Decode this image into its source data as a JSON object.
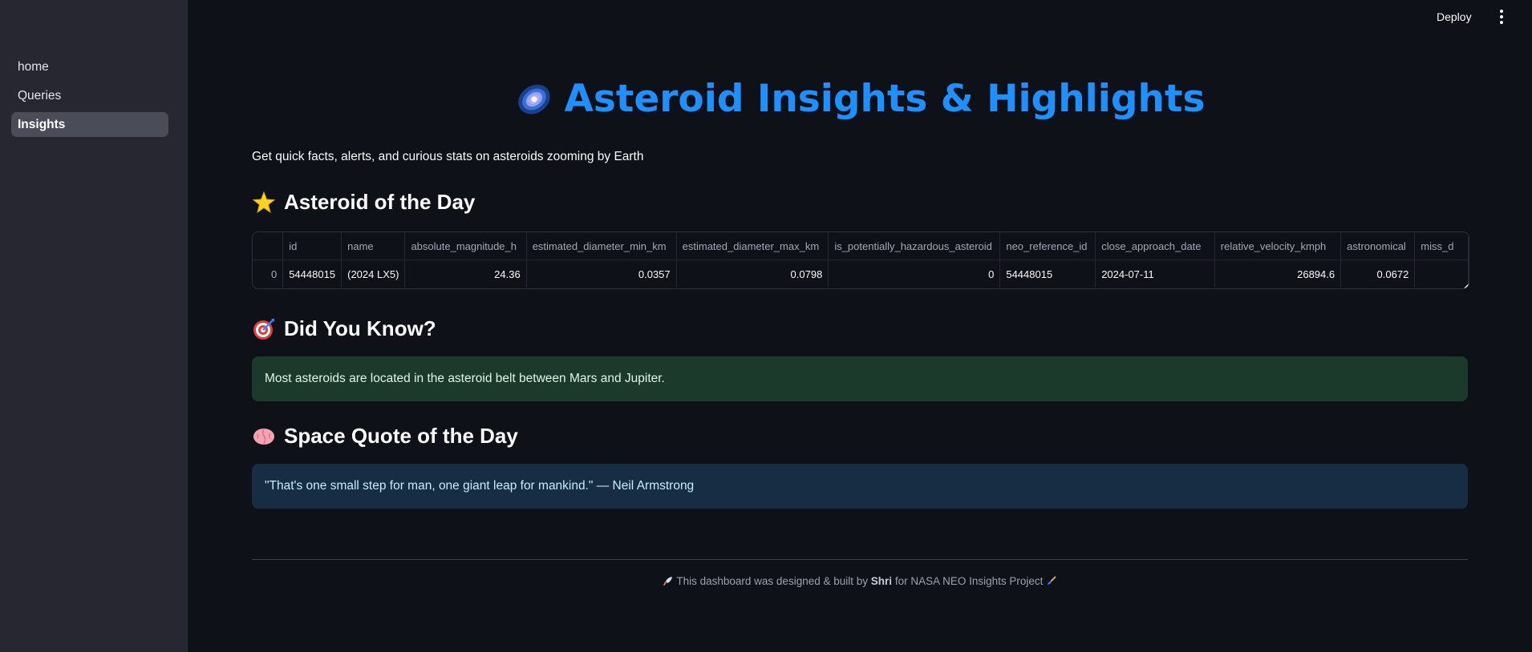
{
  "sidebar": {
    "items": [
      {
        "label": "home",
        "active": false
      },
      {
        "label": "Queries",
        "active": false
      },
      {
        "label": "Insights",
        "active": true
      }
    ]
  },
  "topbar": {
    "deploy_label": "Deploy",
    "menu_icon": "kebab-menu-icon"
  },
  "header": {
    "icon": "galaxy-icon",
    "title": "Asteroid Insights & Highlights",
    "subtitle": "Get quick facts, alerts, and curious stats on asteroids zooming by Earth"
  },
  "asteroid_of_day": {
    "icon": "star-icon",
    "heading": "Asteroid of the Day",
    "columns": [
      "",
      "id",
      "name",
      "absolute_magnitude_h",
      "estimated_diameter_min_km",
      "estimated_diameter_max_km",
      "is_potentially_hazardous_asteroid",
      "neo_reference_id",
      "close_approach_date",
      "relative_velocity_kmph",
      "astronomical",
      "miss_d"
    ],
    "row": [
      "0",
      "54448015",
      "(2024 LX5)",
      "24.36",
      "0.0357",
      "0.0798",
      "0",
      "54448015",
      "2024-07-11",
      "26894.6",
      "0.0672",
      ""
    ]
  },
  "did_you_know": {
    "icon": "target-icon",
    "heading": "Did You Know?",
    "text": "Most asteroids are located in the asteroid belt between Mars and Jupiter."
  },
  "space_quote": {
    "icon": "brain-icon",
    "heading": "Space Quote of the Day",
    "text": "\"That's one small step for man, one giant leap for mankind.\" — Neil Armstrong"
  },
  "footer": {
    "prefix": "This dashboard was designed & built by",
    "author": "Shri",
    "suffix": "for NASA NEO Insights Project"
  },
  "colors": {
    "background": "#0e1117",
    "sidebar": "#262730",
    "title_accent": "#1e90ff",
    "success_bg": "#1b3a2b",
    "info_bg": "#172d43"
  }
}
